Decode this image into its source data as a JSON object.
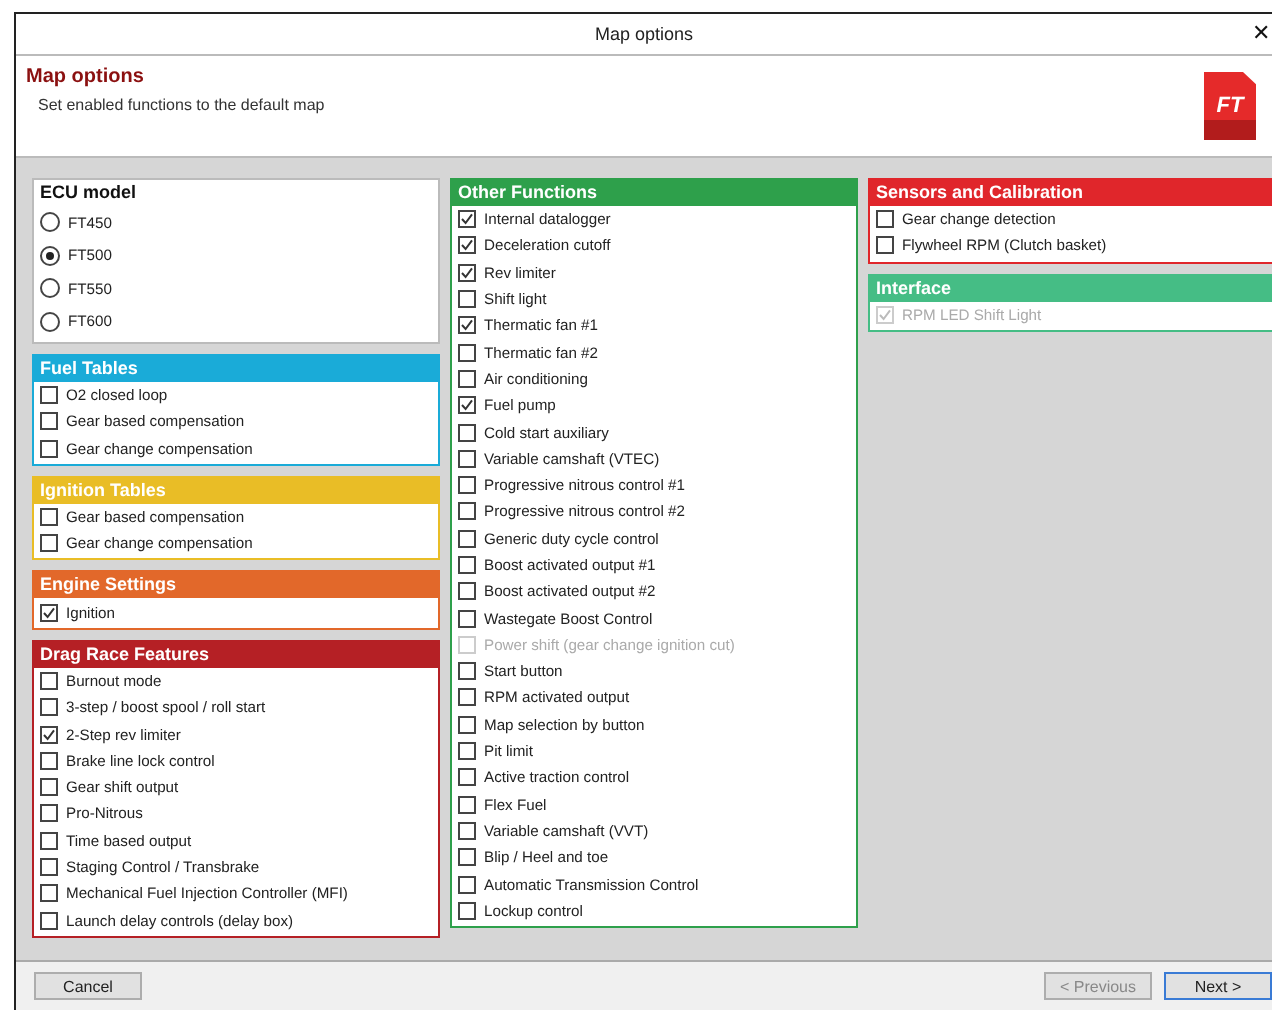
{
  "window": {
    "title": "Map options",
    "close": "✕"
  },
  "header": {
    "title": "Map options",
    "subtitle": "Set enabled functions to the default map",
    "logo": "FT"
  },
  "columns": [
    [
      {
        "title": "ECU model",
        "kind": "radio",
        "color": "#ffffff",
        "items": [
          {
            "label": "FT450",
            "selected": false
          },
          {
            "label": "FT500",
            "selected": true
          },
          {
            "label": "FT550",
            "selected": false
          },
          {
            "label": "FT600",
            "selected": false
          }
        ]
      },
      {
        "title": "Fuel Tables",
        "kind": "check",
        "color": "#1aabd8",
        "items": [
          {
            "label": "O2 closed loop",
            "checked": false,
            "disabled": false
          },
          {
            "label": "Gear based compensation",
            "checked": false,
            "disabled": false
          },
          {
            "label": "Gear change compensation",
            "checked": false,
            "disabled": false
          }
        ]
      },
      {
        "title": "Ignition Tables",
        "kind": "check",
        "color": "#e9bd26",
        "items": [
          {
            "label": "Gear based compensation",
            "checked": false,
            "disabled": false
          },
          {
            "label": "Gear change compensation",
            "checked": false,
            "disabled": false
          }
        ]
      },
      {
        "title": "Engine Settings",
        "kind": "check",
        "color": "#e2682a",
        "items": [
          {
            "label": "Ignition",
            "checked": true,
            "disabled": false
          }
        ]
      },
      {
        "title": "Drag Race Features",
        "kind": "check",
        "color": "#b52025",
        "items": [
          {
            "label": "Burnout mode",
            "checked": false,
            "disabled": false
          },
          {
            "label": "3-step / boost spool / roll start",
            "checked": false,
            "disabled": false
          },
          {
            "label": "2-Step rev limiter",
            "checked": true,
            "disabled": false
          },
          {
            "label": "Brake line lock control",
            "checked": false,
            "disabled": false
          },
          {
            "label": "Gear shift output",
            "checked": false,
            "disabled": false
          },
          {
            "label": "Pro-Nitrous",
            "checked": false,
            "disabled": false
          },
          {
            "label": "Time based output",
            "checked": false,
            "disabled": false
          },
          {
            "label": "Staging Control / Transbrake",
            "checked": false,
            "disabled": false
          },
          {
            "label": "Mechanical Fuel Injection Controller (MFI)",
            "checked": false,
            "disabled": false
          },
          {
            "label": "Launch delay controls (delay box)",
            "checked": false,
            "disabled": false
          }
        ]
      }
    ],
    [
      {
        "title": "Other Functions",
        "kind": "check",
        "color": "#2ea04b",
        "items": [
          {
            "label": "Internal datalogger",
            "checked": true,
            "disabled": false
          },
          {
            "label": "Deceleration cutoff",
            "checked": true,
            "disabled": false
          },
          {
            "label": "Rev limiter",
            "checked": true,
            "disabled": false
          },
          {
            "label": "Shift light",
            "checked": false,
            "disabled": false
          },
          {
            "label": "Thermatic fan #1",
            "checked": true,
            "disabled": false
          },
          {
            "label": "Thermatic fan #2",
            "checked": false,
            "disabled": false
          },
          {
            "label": "Air conditioning",
            "checked": false,
            "disabled": false
          },
          {
            "label": "Fuel pump",
            "checked": true,
            "disabled": false
          },
          {
            "label": "Cold start auxiliary",
            "checked": false,
            "disabled": false
          },
          {
            "label": "Variable camshaft (VTEC)",
            "checked": false,
            "disabled": false
          },
          {
            "label": "Progressive nitrous control #1",
            "checked": false,
            "disabled": false
          },
          {
            "label": "Progressive nitrous control #2",
            "checked": false,
            "disabled": false
          },
          {
            "label": "Generic duty cycle control",
            "checked": false,
            "disabled": false
          },
          {
            "label": "Boost activated output #1",
            "checked": false,
            "disabled": false
          },
          {
            "label": "Boost activated output #2",
            "checked": false,
            "disabled": false
          },
          {
            "label": "Wastegate Boost Control",
            "checked": false,
            "disabled": false
          },
          {
            "label": "Power shift (gear change ignition cut)",
            "checked": false,
            "disabled": true
          },
          {
            "label": "Start button",
            "checked": false,
            "disabled": false
          },
          {
            "label": "RPM activated output",
            "checked": false,
            "disabled": false
          },
          {
            "label": "Map selection by button",
            "checked": false,
            "disabled": false
          },
          {
            "label": "Pit limit",
            "checked": false,
            "disabled": false
          },
          {
            "label": "Active traction control",
            "checked": false,
            "disabled": false
          },
          {
            "label": "Flex Fuel",
            "checked": false,
            "disabled": false
          },
          {
            "label": "Variable camshaft (VVT)",
            "checked": false,
            "disabled": false
          },
          {
            "label": "Blip / Heel and toe",
            "checked": false,
            "disabled": false
          },
          {
            "label": "Automatic Transmission Control",
            "checked": false,
            "disabled": false
          },
          {
            "label": "Lockup control",
            "checked": false,
            "disabled": false
          }
        ]
      }
    ],
    [
      {
        "title": "Sensors and Calibration",
        "kind": "check",
        "color": "#e0262b",
        "items": [
          {
            "label": "Gear change detection",
            "checked": false,
            "disabled": false
          },
          {
            "label": "Flywheel RPM (Clutch basket)",
            "checked": false,
            "disabled": false
          }
        ]
      },
      {
        "title": "Interface",
        "kind": "check",
        "color": "#45bd85",
        "items": [
          {
            "label": "RPM LED Shift Light",
            "checked": true,
            "disabled": true
          }
        ]
      }
    ]
  ],
  "buttons": [
    {
      "label": "Cancel",
      "disabled": false,
      "primary": false
    },
    {
      "label": "< Previous",
      "disabled": true,
      "primary": false
    },
    {
      "label": "Next >",
      "disabled": false,
      "primary": true
    }
  ]
}
